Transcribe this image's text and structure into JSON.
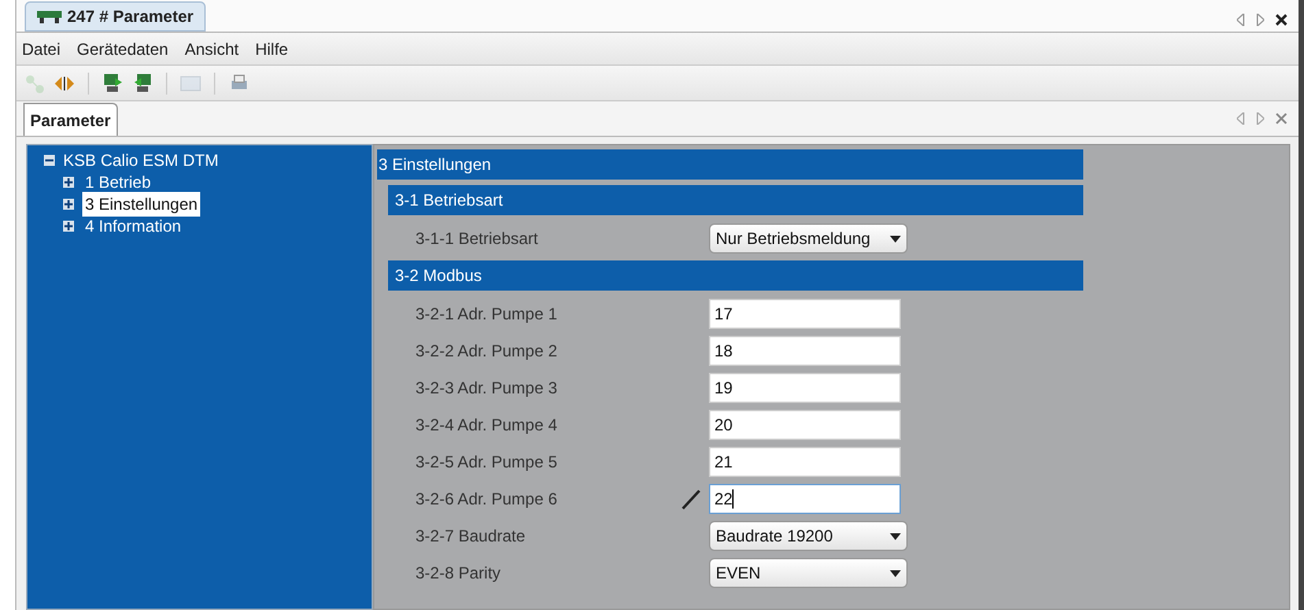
{
  "window": {
    "title": "247 # Parameter"
  },
  "menu": [
    "Datei",
    "Gerätedaten",
    "Ansicht",
    "Hilfe"
  ],
  "toolbar": [
    {
      "kind": "network",
      "disabled": true
    },
    {
      "kind": "arrows",
      "disabled": false
    },
    {
      "kind": "upload",
      "disabled": false
    },
    {
      "kind": "download",
      "disabled": false
    },
    {
      "kind": "window",
      "disabled": true
    },
    {
      "kind": "print",
      "disabled": false
    }
  ],
  "tabs": [
    {
      "label": "Parameter",
      "selected": true
    }
  ],
  "tree": {
    "label": "KSB Calio ESM DTM",
    "expanded": true,
    "children": [
      {
        "label": "1 Betrieb",
        "expanded": false,
        "selected": false
      },
      {
        "label": "3 Einstellungen",
        "expanded": false,
        "selected": true
      },
      {
        "label": "4 Information",
        "expanded": false,
        "selected": false
      }
    ]
  },
  "section": {
    "title": "3 Einstellungen",
    "groups": [
      {
        "title": "3-1 Betriebsart",
        "rows": [
          {
            "label": "3-1-1 Betriebsart",
            "kind": "dropdown",
            "value": "Nur Betriebsmeldung",
            "editing": false
          }
        ]
      },
      {
        "title": "3-2 Modbus",
        "rows": [
          {
            "label": "3-2-1 Adr. Pumpe 1",
            "kind": "text",
            "value": "17",
            "editing": false
          },
          {
            "label": "3-2-2 Adr. Pumpe 2",
            "kind": "text",
            "value": "18",
            "editing": false
          },
          {
            "label": "3-2-3 Adr. Pumpe 3",
            "kind": "text",
            "value": "19",
            "editing": false
          },
          {
            "label": "3-2-4 Adr. Pumpe 4",
            "kind": "text",
            "value": "20",
            "editing": false
          },
          {
            "label": "3-2-5 Adr. Pumpe 5",
            "kind": "text",
            "value": "21",
            "editing": false
          },
          {
            "label": "3-2-6 Adr. Pumpe 6",
            "kind": "text",
            "value": "22",
            "editing": true
          },
          {
            "label": "3-2-7 Baudrate",
            "kind": "dropdown",
            "value": "Baudrate 19200",
            "editing": false
          },
          {
            "label": "3-2-8 Parity",
            "kind": "dropdown",
            "value": "EVEN",
            "editing": false
          }
        ]
      }
    ]
  }
}
